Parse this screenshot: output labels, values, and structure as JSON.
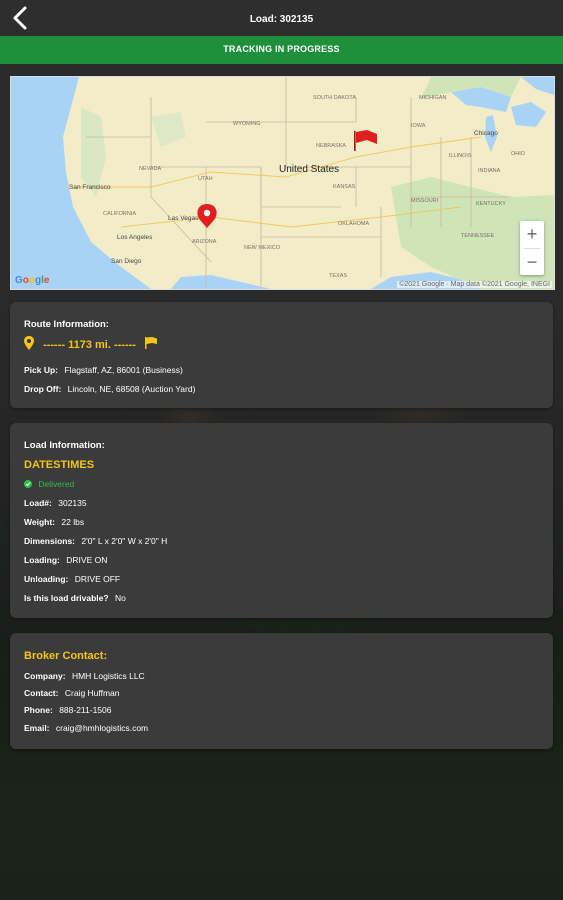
{
  "header": {
    "title": "Load: 302135"
  },
  "status_banner": {
    "text": "TRACKING IN PROGRESS",
    "color": "#1e8f3a"
  },
  "map": {
    "labels": {
      "country": "United States",
      "states": [
        "SOUTH DAKOTA",
        "WYOMING",
        "NEBRASKA",
        "NEVADA",
        "UTAH",
        "KANSAS",
        "CALIFORNIA",
        "ARIZONA",
        "OKLAHOMA",
        "NEW MEXICO",
        "TEXAS",
        "MISSOURI",
        "IOWA",
        "KENTUCKY",
        "TENNESSEE",
        "ILLINOIS",
        "INDIANA",
        "OHIO",
        "MICHIGAN"
      ],
      "cities": [
        "San Francisco",
        "Las Vegas",
        "Los Angeles",
        "San Diego",
        "Chicago"
      ]
    },
    "zoom_in": "+",
    "zoom_out": "−",
    "google_logo": "Google",
    "copyright": "©2021 Google · Map data ©2021 Google, INEGI"
  },
  "route": {
    "title": "Route Information:",
    "distance": "------ 1173 mi. ------",
    "pickup_label": "Pick Up:",
    "pickup_value": "Flagstaff, AZ, 86001 (Business)",
    "dropoff_label": "Drop Off:",
    "dropoff_value": "Lincoln, NE, 68508 (Auction Yard)"
  },
  "load": {
    "title": "Load Information:",
    "datetimes": "DATESTIMES",
    "status": "Delivered",
    "load_label": "Load#:",
    "load_value": "302135",
    "weight_label": "Weight:",
    "weight_value": "22 lbs",
    "dimensions_label": "Dimensions:",
    "dimensions_value": "2'0\" L x 2'0\" W x 2'0\" H",
    "loading_label": "Loading:",
    "loading_value": "DRIVE ON",
    "unloading_label": "Unloading:",
    "unloading_value": "DRIVE OFF",
    "drivable_label": "Is this load drivable?",
    "drivable_value": "No"
  },
  "broker": {
    "title": "Broker Contact:",
    "company_label": "Company:",
    "company_value": "HMH Logistics LLC",
    "contact_label": "Contact:",
    "contact_value": "Craig Huffman",
    "phone_label": "Phone:",
    "phone_value": "888-211-1506",
    "email_label": "Email:",
    "email_value": "craig@hmhlogistics.com"
  },
  "colors": {
    "accent_yellow": "#f5c518",
    "delivered_green": "#2fbf4a",
    "card_bg": "#3b3b3b",
    "pin_red": "#e02020"
  },
  "icons": [
    "back-arrow-icon",
    "location-pin-icon",
    "flag-icon",
    "check-circle-icon",
    "map-pin-icon",
    "map-flag-icon"
  ]
}
